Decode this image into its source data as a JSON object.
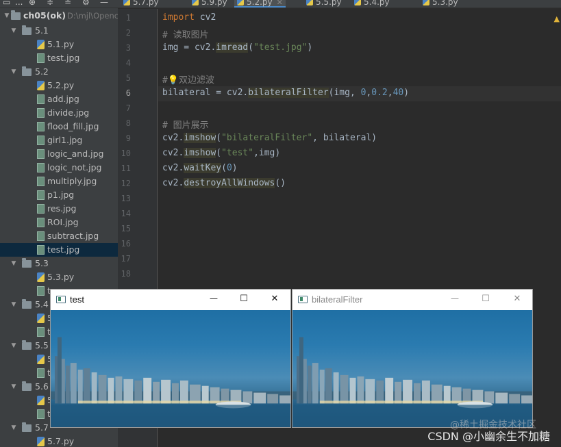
{
  "tree": {
    "root": {
      "label": "ch05(ok)",
      "path": "D:\\mjl\\Openc"
    },
    "items": [
      {
        "type": "folder",
        "label": "5.1",
        "expanded": true,
        "level": 1
      },
      {
        "type": "py",
        "label": "5.1.py",
        "level": 2
      },
      {
        "type": "img",
        "label": "test.jpg",
        "level": 2
      },
      {
        "type": "folder",
        "label": "5.2",
        "expanded": true,
        "level": 1
      },
      {
        "type": "py",
        "label": "5.2.py",
        "level": 2
      },
      {
        "type": "img",
        "label": "add.jpg",
        "level": 2
      },
      {
        "type": "img",
        "label": "divide.jpg",
        "level": 2
      },
      {
        "type": "img",
        "label": "flood_fill.jpg",
        "level": 2
      },
      {
        "type": "img",
        "label": "girl1.jpg",
        "level": 2
      },
      {
        "type": "img",
        "label": "logic_and.jpg",
        "level": 2
      },
      {
        "type": "img",
        "label": "logic_not.jpg",
        "level": 2
      },
      {
        "type": "img",
        "label": "multiply.jpg",
        "level": 2
      },
      {
        "type": "img",
        "label": "p1.jpg",
        "level": 2
      },
      {
        "type": "img",
        "label": "res.jpg",
        "level": 2
      },
      {
        "type": "img",
        "label": "ROI.jpg",
        "level": 2
      },
      {
        "type": "img",
        "label": "subtract.jpg",
        "level": 2
      },
      {
        "type": "img",
        "label": "test.jpg",
        "level": 2,
        "selected": true
      },
      {
        "type": "folder",
        "label": "5.3",
        "expanded": true,
        "level": 1
      },
      {
        "type": "py",
        "label": "5.3.py",
        "level": 2
      },
      {
        "type": "img",
        "label": "t",
        "level": 2
      },
      {
        "type": "folder",
        "label": "5.4",
        "expanded": true,
        "level": 1
      },
      {
        "type": "py",
        "label": "5",
        "level": 2
      },
      {
        "type": "img",
        "label": "t",
        "level": 2
      },
      {
        "type": "folder",
        "label": "5.5",
        "expanded": true,
        "level": 1
      },
      {
        "type": "py",
        "label": "5",
        "level": 2
      },
      {
        "type": "img",
        "label": "t",
        "level": 2
      },
      {
        "type": "folder",
        "label": "5.6",
        "expanded": true,
        "level": 1
      },
      {
        "type": "py",
        "label": "5",
        "level": 2
      },
      {
        "type": "img",
        "label": "t",
        "level": 2
      },
      {
        "type": "folder",
        "label": "5.7",
        "expanded": true,
        "level": 1
      },
      {
        "type": "py",
        "label": "5.7.py",
        "level": 2
      }
    ]
  },
  "toolbar": {
    "more": "...",
    "add_icon": "⊕",
    "collapse_icon": "≑",
    "expand_icon": "≐"
  },
  "tabs": [
    {
      "label": "5.7.py",
      "active": false
    },
    {
      "label": "5.9.py",
      "active": false
    },
    {
      "label": "5.2.py",
      "active": true
    },
    {
      "label": "5.5.py",
      "active": false
    },
    {
      "label": "5.4.py",
      "active": false
    },
    {
      "label": "5.3.py",
      "active": false
    }
  ],
  "editor": {
    "line_numbers": [
      "1",
      "2",
      "3",
      "4",
      "5",
      "6",
      "7",
      "8",
      "9",
      "10",
      "11",
      "12",
      "13",
      "14",
      "15",
      "16",
      "17",
      "18"
    ],
    "current_line": 6,
    "lines": [
      [
        {
          "t": "import",
          "c": "kw"
        },
        {
          "t": " cv2",
          "c": ""
        }
      ],
      [
        {
          "t": "# 读取图片",
          "c": "cm"
        }
      ],
      [
        {
          "t": "img = cv2.",
          "c": ""
        },
        {
          "t": "imread",
          "c": "hl"
        },
        {
          "t": "(",
          "c": ""
        },
        {
          "t": "\"test.jpg\"",
          "c": "str"
        },
        {
          "t": ")",
          "c": ""
        }
      ],
      [],
      [
        {
          "t": "#",
          "c": "cm"
        },
        {
          "t": "💡",
          "c": "bulb"
        },
        {
          "t": "双边滤波",
          "c": "cm"
        }
      ],
      [
        {
          "t": "bilateral = cv2.",
          "c": ""
        },
        {
          "t": "bilateralFilter",
          "c": "hl"
        },
        {
          "t": "(img, ",
          "c": ""
        },
        {
          "t": "0",
          "c": "num"
        },
        {
          "t": ",",
          "c": ""
        },
        {
          "t": "0.2",
          "c": "num"
        },
        {
          "t": ",",
          "c": ""
        },
        {
          "t": "40",
          "c": "num"
        },
        {
          "t": ")",
          "c": ""
        }
      ],
      [],
      [
        {
          "t": "# 图片展示",
          "c": "cm"
        }
      ],
      [
        {
          "t": "cv2.",
          "c": ""
        },
        {
          "t": "imshow",
          "c": "hl"
        },
        {
          "t": "(",
          "c": ""
        },
        {
          "t": "\"bilateralFilter\"",
          "c": "str"
        },
        {
          "t": ", bilateral)",
          "c": ""
        }
      ],
      [
        {
          "t": "cv2.",
          "c": ""
        },
        {
          "t": "imshow",
          "c": "hl"
        },
        {
          "t": "(",
          "c": ""
        },
        {
          "t": "\"test\"",
          "c": "str"
        },
        {
          "t": ",img)",
          "c": ""
        }
      ],
      [
        {
          "t": "cv2.",
          "c": ""
        },
        {
          "t": "waitKey",
          "c": "hl"
        },
        {
          "t": "(",
          "c": ""
        },
        {
          "t": "0",
          "c": "num"
        },
        {
          "t": ")",
          "c": ""
        }
      ],
      [
        {
          "t": "cv2.",
          "c": ""
        },
        {
          "t": "destroyAllWindows",
          "c": "hl"
        },
        {
          "t": "()",
          "c": ""
        }
      ]
    ]
  },
  "windows": [
    {
      "title": "test",
      "active": true,
      "minimize": "—",
      "maximize": "☐",
      "close": "✕"
    },
    {
      "title": "bilateralFilter",
      "active": false,
      "minimize": "—",
      "maximize": "☐",
      "close": "✕"
    }
  ],
  "watermark": {
    "juejin": "@稀土掘金技术社区",
    "csdn": "CSDN @小幽余生不加糖"
  }
}
